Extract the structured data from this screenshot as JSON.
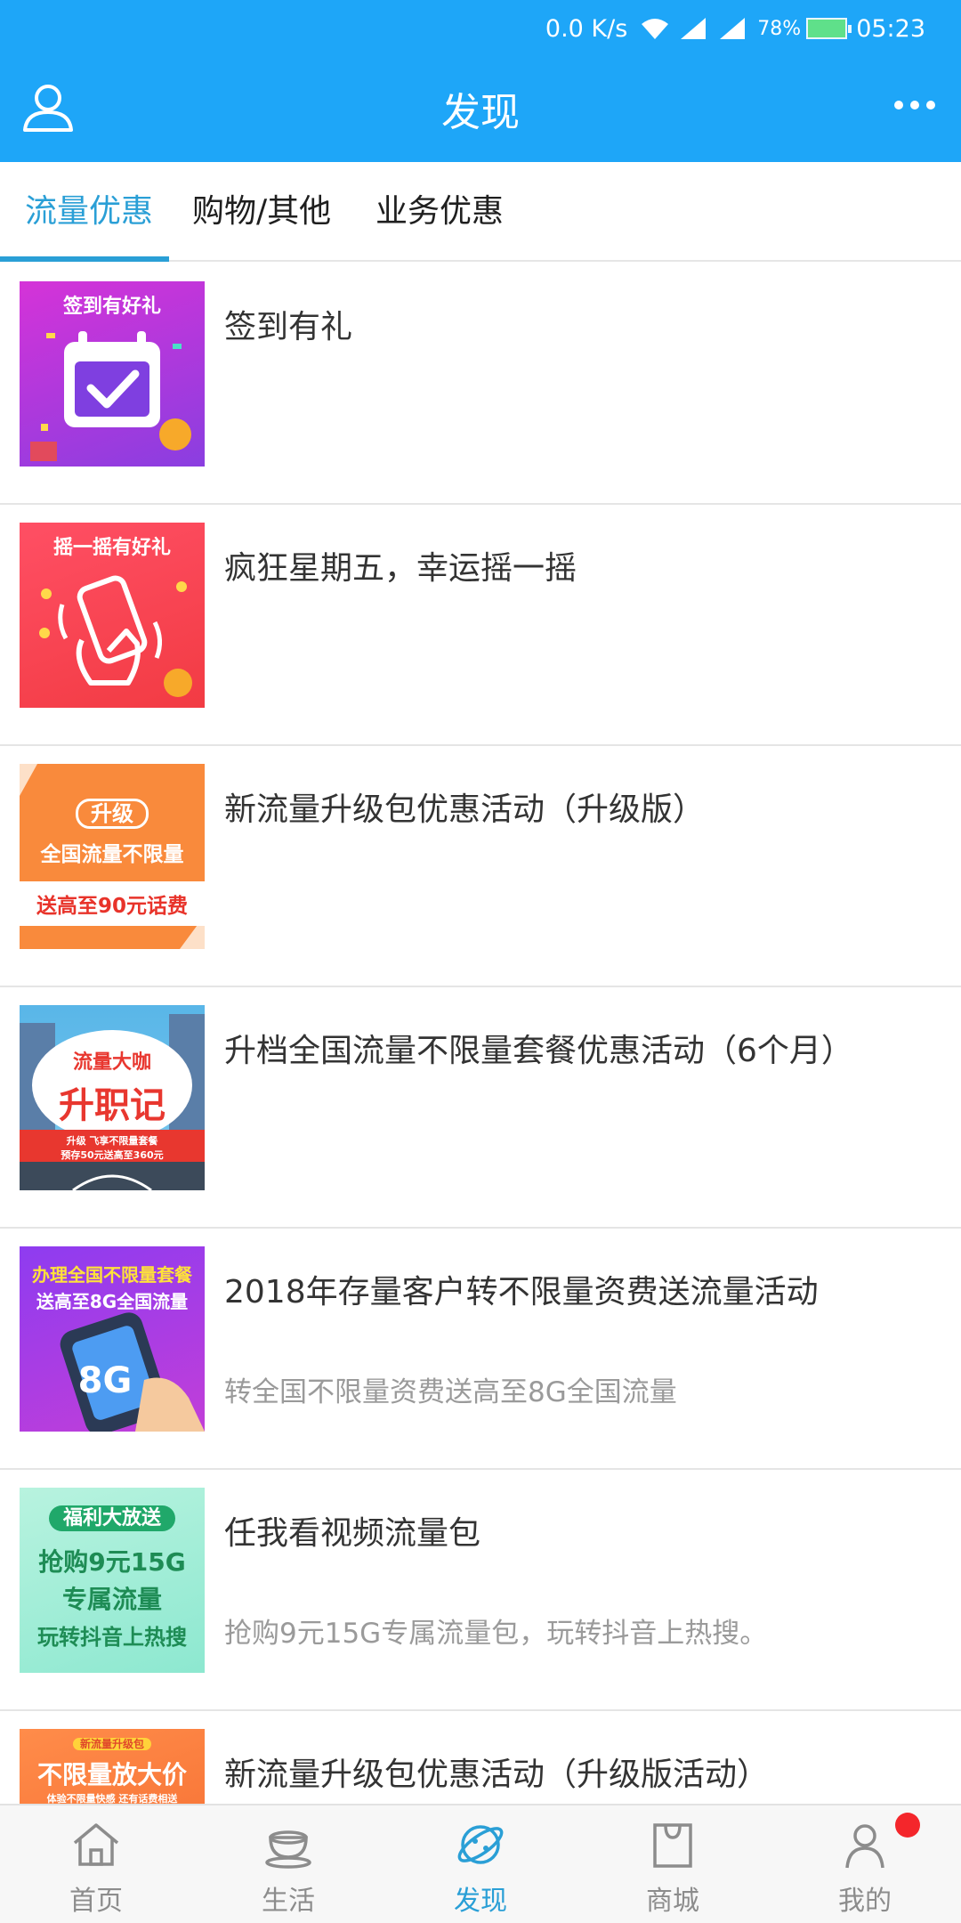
{
  "status_bar": {
    "speed": "0.0 K/s",
    "battery": "78%",
    "time": "05:23"
  },
  "header": {
    "title": "发现",
    "user_icon": "user-icon",
    "more_icon": "more-icon"
  },
  "tabs": [
    {
      "label": "流量优惠",
      "active": true
    },
    {
      "label": "购物/其他",
      "active": false
    },
    {
      "label": "业务优惠",
      "active": false
    }
  ],
  "items": [
    {
      "title": "签到有礼",
      "subtitle": "",
      "thumb": {
        "banner": "签到有好礼"
      }
    },
    {
      "title": "疯狂星期五，幸运摇一摇",
      "subtitle": "",
      "thumb": {
        "banner": "摇一摇有好礼"
      }
    },
    {
      "title": "新流量升级包优惠活动（升级版）",
      "subtitle": "",
      "thumb": {
        "line1": "升级",
        "line2": "全国流量不限量",
        "line3": "送高至90元话费"
      }
    },
    {
      "title": "升档全国流量不限量套餐优惠活动（6个月）",
      "subtitle": "",
      "thumb": {
        "line1": "流量大咖",
        "line2": "升职记",
        "line3": "升级 飞享不限量套餐",
        "line4": "预存50元送高至360元"
      }
    },
    {
      "title": "2018年存量客户转不限量资费送流量活动",
      "subtitle": "转全国不限量资费送高至8G全国流量",
      "thumb": {
        "line1": "办理全国不限量套餐",
        "line2": "送高至8G全国流量",
        "line3": "8G"
      }
    },
    {
      "title": "任我看视频流量包",
      "subtitle": "抢购9元15G专属流量包，玩转抖音上热搜。",
      "thumb": {
        "line1": "福利大放送",
        "line2": "抢购9元15G",
        "line3": "专属流量",
        "line4": "玩转抖音上热搜"
      }
    },
    {
      "title": "新流量升级包优惠活动（升级版活动）",
      "subtitle": "",
      "thumb": {
        "line1": "新流量升级包",
        "line2": "不限量放大价",
        "line3": "体验不限量快感 还有话费相送"
      }
    }
  ],
  "bottom_nav": [
    {
      "label": "首页",
      "icon": "home-icon",
      "active": false
    },
    {
      "label": "生活",
      "icon": "cup-icon",
      "active": false
    },
    {
      "label": "发现",
      "icon": "planet-icon",
      "active": true
    },
    {
      "label": "商城",
      "icon": "bag-icon",
      "active": false
    },
    {
      "label": "我的",
      "icon": "person-icon",
      "active": false,
      "badge": true
    }
  ],
  "colors": {
    "header_bg": "#1ea6f8",
    "accent": "#2a9fd6",
    "badge": "#f4262b"
  }
}
